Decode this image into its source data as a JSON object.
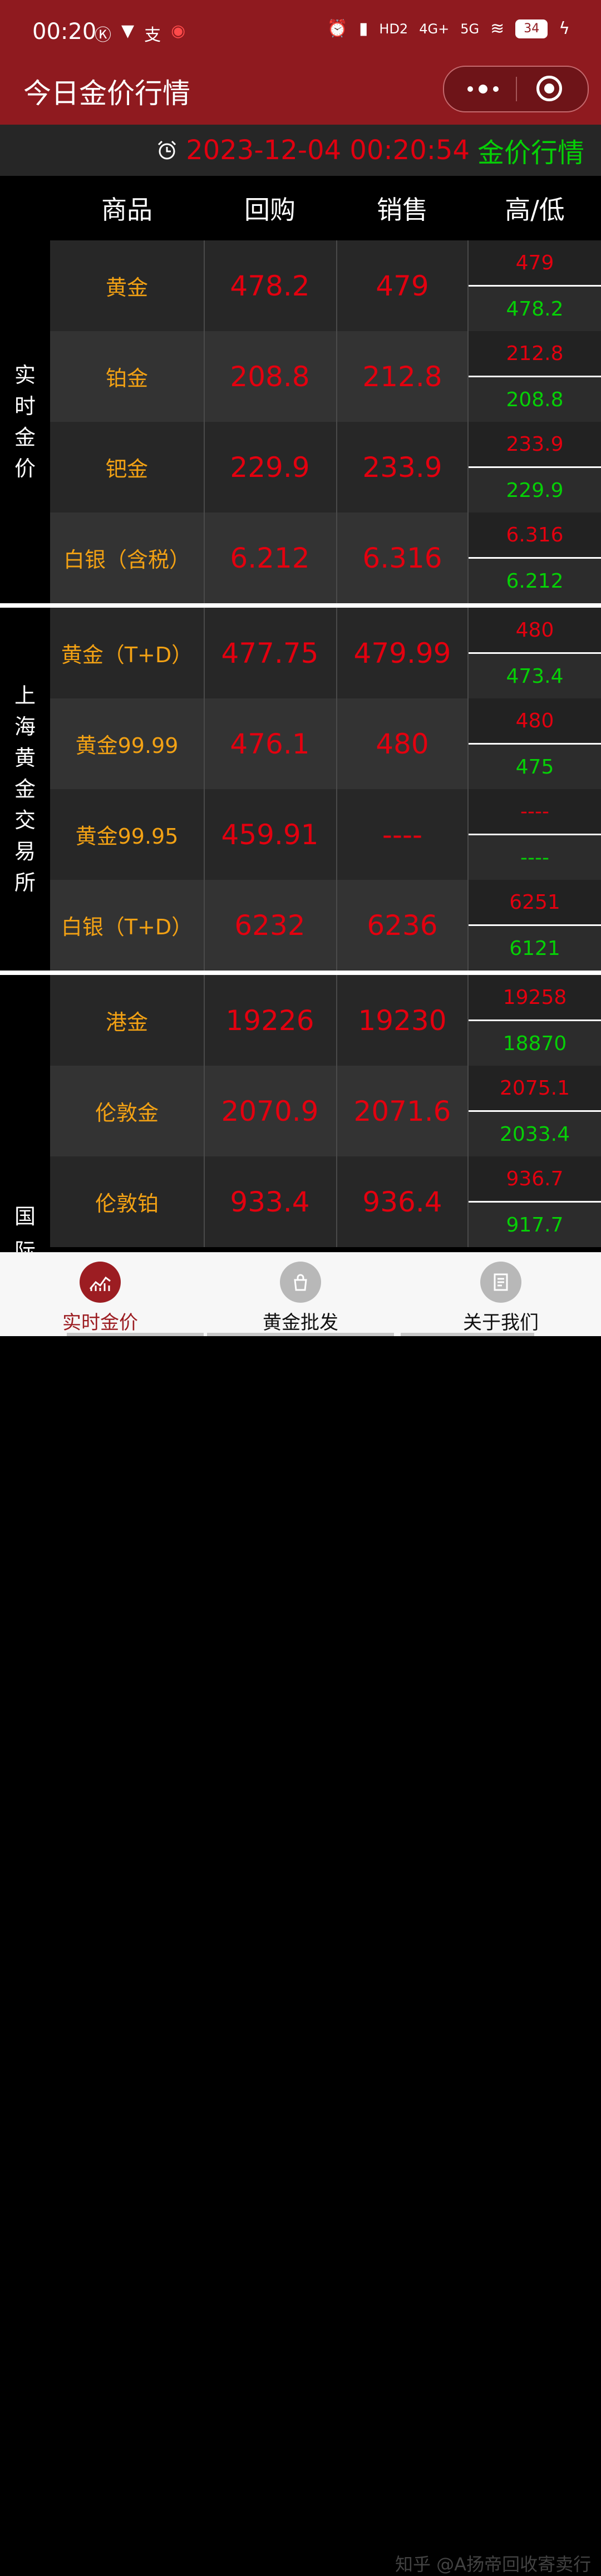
{
  "status_bar": {
    "time": "00:20",
    "network": "4G+",
    "network2": "5G",
    "hd": "HD2",
    "battery": "34"
  },
  "nav": {
    "title": "今日金价行情"
  },
  "timestamp": {
    "datetime": "2023-12-04 00:20:54",
    "tag": "金价行情"
  },
  "table_header": {
    "product": "商品",
    "buy": "回购",
    "sell": "销售",
    "high_low": "高/低"
  },
  "sections": [
    {
      "label": [
        "实",
        "时",
        "金",
        "价"
      ],
      "rows": [
        {
          "name": "黄金",
          "buy": "478.2",
          "sell": "479",
          "high": "479",
          "low": "478.2"
        },
        {
          "name": "铂金",
          "buy": "208.8",
          "sell": "212.8",
          "high": "212.8",
          "low": "208.8"
        },
        {
          "name": "钯金",
          "buy": "229.9",
          "sell": "233.9",
          "high": "233.9",
          "low": "229.9"
        },
        {
          "name": "白银（含税）",
          "buy": "6.212",
          "sell": "6.316",
          "high": "6.316",
          "low": "6.212"
        }
      ]
    },
    {
      "label": [
        "上",
        "海",
        "黄",
        "金",
        "交",
        "易",
        "所"
      ],
      "rows": [
        {
          "name": "黄金（T+D）",
          "buy": "477.75",
          "sell": "479.99",
          "high": "480",
          "low": "473.4"
        },
        {
          "name": "黄金99.99",
          "buy": "476.1",
          "sell": "480",
          "high": "480",
          "low": "475"
        },
        {
          "name": "黄金99.95",
          "buy": "459.91",
          "sell": "----",
          "high": "----",
          "low": "----"
        },
        {
          "name": "白银（T+D）",
          "buy": "6232",
          "sell": "6236",
          "high": "6251",
          "low": "6121"
        }
      ]
    },
    {
      "label": [
        "国",
        "际"
      ],
      "rows": [
        {
          "name": "港金",
          "buy": "19226",
          "sell": "19230",
          "high": "19258",
          "low": "18870"
        },
        {
          "name": "伦敦金",
          "buy": "2070.9",
          "sell": "2071.6",
          "high": "2075.1",
          "low": "2033.4"
        },
        {
          "name": "伦敦铂",
          "buy": "933.4",
          "sell": "936.4",
          "high": "936.7",
          "low": "917.7"
        }
      ]
    }
  ],
  "tabbar": {
    "tabs": [
      {
        "label": "实时金价",
        "icon": "chart-icon",
        "active": true
      },
      {
        "label": "黄金批发",
        "icon": "bag-icon",
        "active": false
      },
      {
        "label": "关于我们",
        "icon": "document-icon",
        "active": false
      }
    ]
  },
  "watermark": "知乎 @A扬帝回收寄卖行",
  "colors": {
    "brand": "#8f1a1f",
    "price_red": "#e3000f",
    "low_green": "#06d006",
    "name_orange": "#f2a114"
  }
}
